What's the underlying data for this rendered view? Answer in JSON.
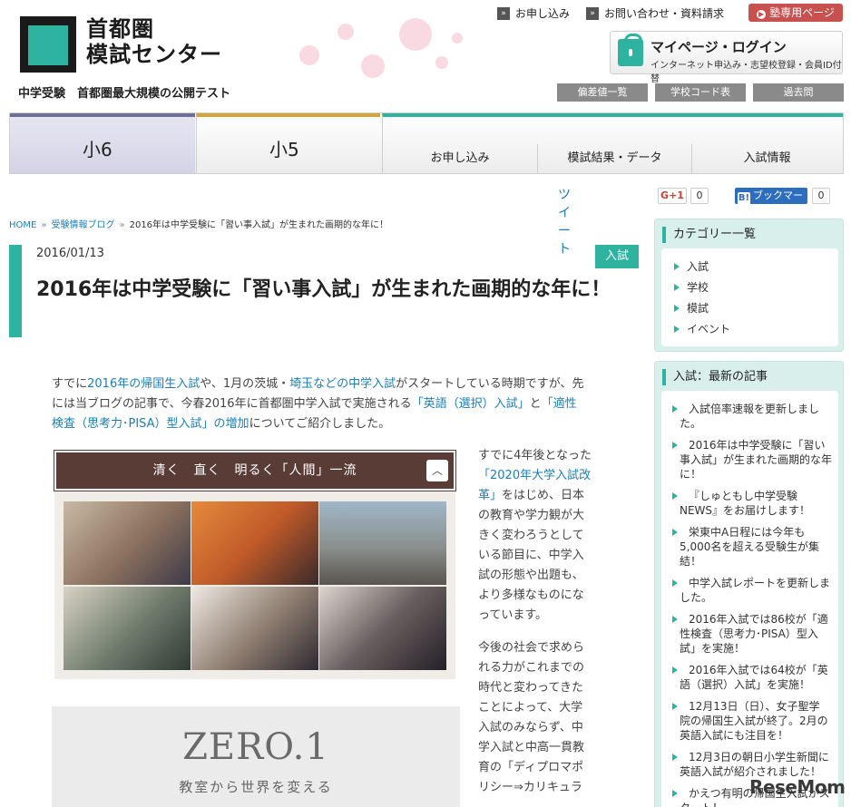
{
  "brand": {
    "line1": "首都圏",
    "line2": "模試センター",
    "tagline": "中学受験　首都圏最大規模の公開テスト"
  },
  "top_links": [
    {
      "label": "お申し込み"
    },
    {
      "label": "お問い合わせ・資料請求"
    }
  ],
  "juku_button": "塾専用ページ",
  "mypage": {
    "title": "マイページ・ログイン",
    "subtitle": "インターネット申込み・志望校登録・会員ID付替"
  },
  "gray_buttons": [
    "偏差値一覧",
    "学校コード表",
    "過去問"
  ],
  "nav": {
    "tabs": [
      "小6",
      "小5"
    ],
    "sub": [
      "お申し込み",
      "模試結果・データ",
      "入試情報"
    ]
  },
  "social": {
    "tweet": "ツイート",
    "gplus": "G+1",
    "gplus_count": "0",
    "hatena": "ブックマーク",
    "hatena_count": "0"
  },
  "breadcrumb": [
    "HOME",
    "受験情報ブログ",
    "2016年は中学受験に「習い事入試」が生まれた画期的な年に！"
  ],
  "article": {
    "date": "2016/01/13",
    "category": "入試",
    "title": "2016年は中学受験に「習い事入試」が生まれた画期的な年に！",
    "intro": {
      "p1": "すでに",
      "l1": "2016年の帰国生入試",
      "p2": "や、1月の茨城・",
      "l2": "埼玉などの中学入試",
      "p3": "がスタートしている時期ですが、先には当ブログの記事で、今春2016年に首都圏中学入試で実施される",
      "l3": "「英語（選択）入試」",
      "p4": "と",
      "l4": "「適性検査（思考力･PISA）型入試」の増加",
      "p5": "についてご紹介しました。"
    },
    "col2": {
      "p1": "すでに4年後となった",
      "l1": "「2020年大学入試改革」",
      "p2": "をはじめ、日本の教育や学力観が大きく変わろうとしている節目に、中学入試の形態や出題も、より多様なものになっています。",
      "p3": "今後の社会で求められる力がこれまでの時代と変わってきたことによって、大学入試のみならず、中学入試と中高一貫教育の「ディプロマポリシー⇒カリキュラ"
    }
  },
  "banner": {
    "headline": "清く　直く　明るく「人間」一流"
  },
  "zero": {
    "title": "ZERO.1",
    "subtitle": "教室から世界を変える"
  },
  "sidebar": {
    "categories": {
      "title": "カテゴリー一覧",
      "items": [
        "入試",
        "学校",
        "模試",
        "イベント"
      ]
    },
    "latest": {
      "title": "入試：最新の記事",
      "items": [
        [
          "入試倍率速報を更新しまし",
          "た。"
        ],
        [
          "2016年は中学受験に「習い",
          "事入試」が生まれた画期的な年",
          "に！"
        ],
        [
          "『しゅともし中学受験",
          "NEWS』をお届けします！"
        ],
        [
          "栄東中A日程には今年も",
          "5,000名を超える受験生が集",
          "結！"
        ],
        [
          "中学入試レポートを更新しま",
          "した。"
        ],
        [
          "2016年入試では86校が「適",
          "性検査（思考力･PISA）型入",
          "試」を実施！"
        ],
        [
          "2016年入試では64校が「英",
          "語（選択）入試」を実施！"
        ],
        [
          "12月13日（日）、女子聖学",
          "院の帰国生入試が終了。2月の",
          "英語入試にも注目を！"
        ],
        [
          "12月3日の朝日小学生新聞に",
          "英語入試が紹介されました！"
        ],
        [
          "かえつ有明の帰国生入試がス",
          "タート！"
        ]
      ]
    }
  },
  "watermark": "ReseMom",
  "colors": {
    "accent": "#2db3a0",
    "banner": "#5a3c37",
    "juku": "#c8504f",
    "link": "#1a7fb8"
  }
}
